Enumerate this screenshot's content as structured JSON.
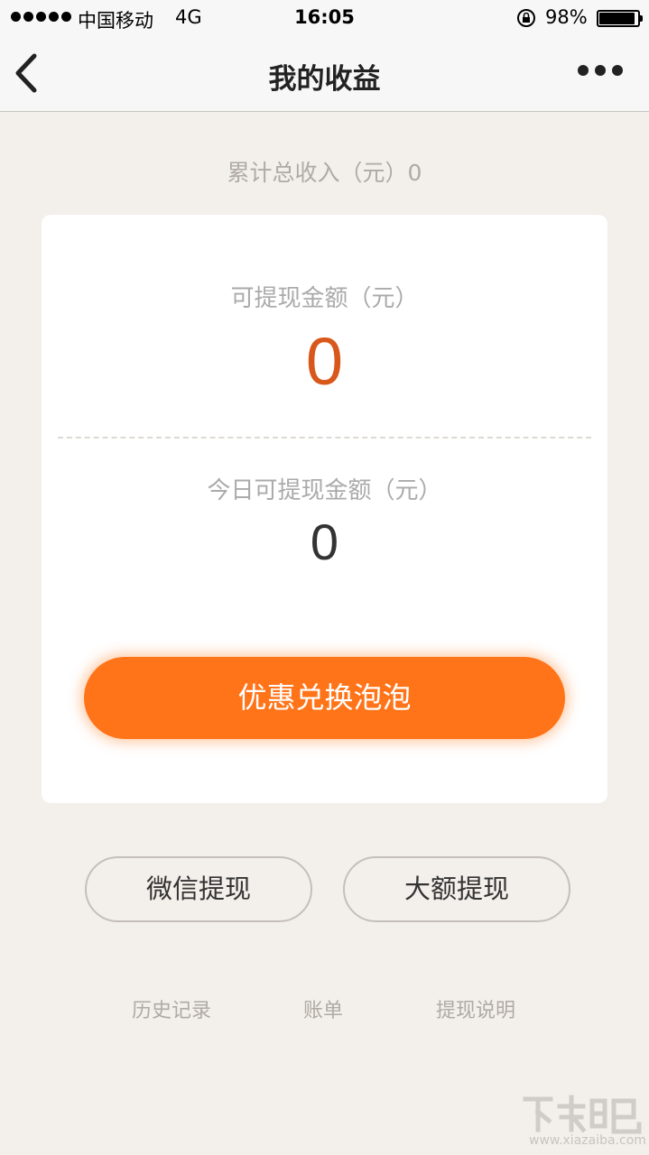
{
  "status_bar": {
    "carrier": "中国移动",
    "network": "4G",
    "time": "16:05",
    "battery": "98%",
    "battery_level": 0.98
  },
  "nav": {
    "title": "我的收益",
    "back_icon": "chevron-left-icon",
    "more_icon": "more-dots-icon"
  },
  "total_income": {
    "label": "累计总收入（元）0"
  },
  "card": {
    "available_label": "可提现金额（元）",
    "available_value": "0",
    "today_label": "今日可提现金额（元）",
    "today_value": "0",
    "exchange_button": "优惠兑换泡泡"
  },
  "actions": {
    "wechat_withdraw": "微信提现",
    "large_withdraw": "大额提现"
  },
  "links": {
    "history": "历史记录",
    "bill": "账单",
    "help": "提现说明"
  },
  "watermark": {
    "text": "www.xiazaiba.com"
  },
  "colors": {
    "accent": "#ff7419",
    "amount": "#d8581c",
    "background": "#f3efea"
  }
}
